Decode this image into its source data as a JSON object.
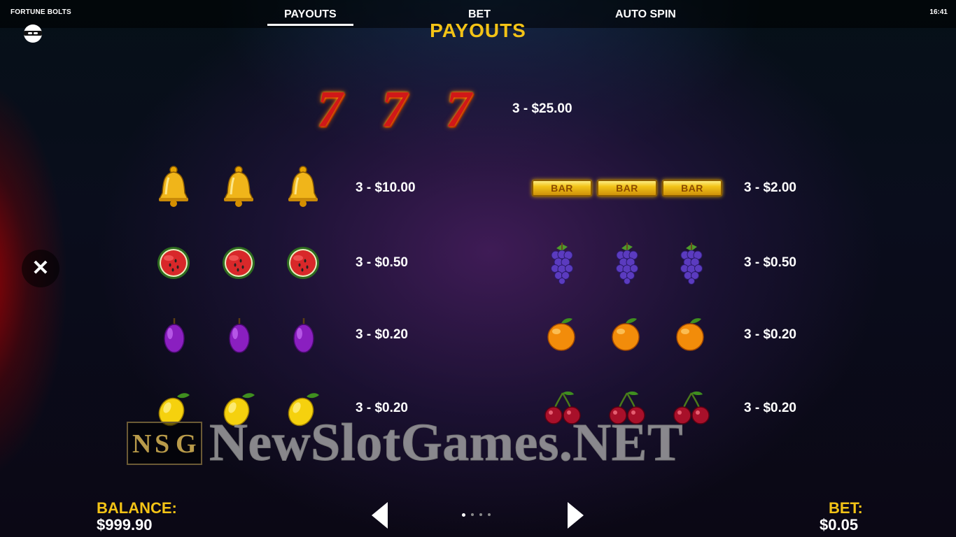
{
  "header": {
    "game_title": "FORTUNE BOLTS",
    "clock": "16:41",
    "tabs": [
      {
        "label": "PAYOUTS",
        "active": true
      },
      {
        "label": "BET",
        "active": false
      },
      {
        "label": "AUTO SPIN",
        "active": false
      }
    ]
  },
  "page": {
    "heading": "PAYOUTS",
    "close_label": "✕"
  },
  "paytable": {
    "sevens": {
      "symbol": "7",
      "payout": "3 - $25.00"
    },
    "bells": {
      "payout": "3 - $10.00"
    },
    "bars": {
      "symbol_text": "BAR",
      "payout": "3 - $2.00"
    },
    "watermelons": {
      "payout": "3 - $0.50"
    },
    "grapes": {
      "payout": "3 - $0.50"
    },
    "plums": {
      "payout": "3 - $0.20"
    },
    "oranges": {
      "payout": "3 - $0.20"
    },
    "lemons": {
      "payout": "3 - $0.20"
    },
    "cherries": {
      "payout": "3 - $0.20"
    }
  },
  "watermark": {
    "logo_letters": [
      "N",
      "S",
      "G"
    ],
    "text": "NewSlotGames.NET"
  },
  "footer": {
    "balance_label": "BALANCE:",
    "balance_value": "$999.90",
    "bet_label": "BET:",
    "bet_value": "$0.05",
    "pages_total": 4,
    "page_current": 1
  },
  "colors": {
    "accent_gold": "#f3c316",
    "seven_red": "#d11818"
  }
}
